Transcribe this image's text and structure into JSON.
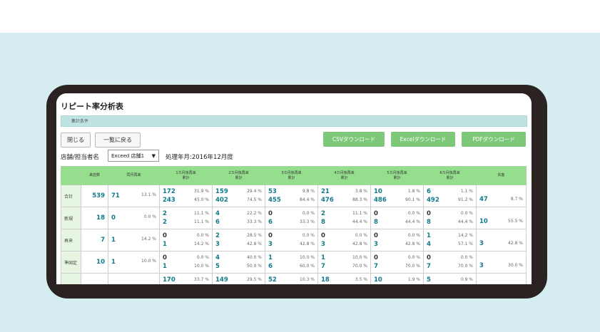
{
  "title": "リピート率分析表",
  "conditions_label": "集計条件",
  "buttons": {
    "close": "閉じる",
    "back": "一覧に戻る",
    "csv": "CSVダウンロード",
    "excel": "Excelダウンロード",
    "pdf": "PDFダウンロード"
  },
  "filter": {
    "label": "店舗/担当者名",
    "value": "Exceed 店舗1",
    "month_label": "処理年月:2016年12月度"
  },
  "headers": [
    "来店数",
    "同月再来",
    "1カ月後再来\n累計",
    "2カ月後再来\n累計",
    "3カ月後再来\n累計",
    "4カ月後再来\n累計",
    "5カ月後再来\n累計",
    "6カ月後再来\n累計",
    "失客"
  ],
  "rows": [
    {
      "label": "合計",
      "visits": "539",
      "same": "71",
      "same_pct": "13.1 %",
      "months": [
        [
          [
            "172",
            "31.9 %"
          ],
          [
            "243",
            "45.0 %"
          ]
        ],
        [
          [
            "159",
            "29.4 %"
          ],
          [
            "402",
            "74.5 %"
          ]
        ],
        [
          [
            "53",
            "9.8 %"
          ],
          [
            "455",
            "84.4 %"
          ]
        ],
        [
          [
            "21",
            "3.8 %"
          ],
          [
            "476",
            "88.3 %"
          ]
        ],
        [
          [
            "10",
            "1.8 %"
          ],
          [
            "486",
            "90.1 %"
          ]
        ],
        [
          [
            "6",
            "1.1 %"
          ],
          [
            "492",
            "91.2 %"
          ]
        ]
      ],
      "lost": "47",
      "lost_pct": "8.7 %"
    },
    {
      "label": "新規",
      "visits": "18",
      "same": "0",
      "same_pct": "0.0 %",
      "months": [
        [
          [
            "2",
            "11.1 %"
          ],
          [
            "2",
            "11.1 %"
          ]
        ],
        [
          [
            "4",
            "22.2 %"
          ],
          [
            "6",
            "33.3 %"
          ]
        ],
        [
          [
            "0",
            "0.0 %"
          ],
          [
            "6",
            "33.3 %"
          ]
        ],
        [
          [
            "2",
            "11.1 %"
          ],
          [
            "8",
            "44.4 %"
          ]
        ],
        [
          [
            "0",
            "0.0 %"
          ],
          [
            "8",
            "44.4 %"
          ]
        ],
        [
          [
            "0",
            "0.0 %"
          ],
          [
            "8",
            "44.4 %"
          ]
        ]
      ],
      "lost": "10",
      "lost_pct": "55.5 %"
    },
    {
      "label": "再来",
      "visits": "7",
      "same": "1",
      "same_pct": "14.2 %",
      "months": [
        [
          [
            "0",
            "0.0 %"
          ],
          [
            "1",
            "14.2 %"
          ]
        ],
        [
          [
            "2",
            "28.5 %"
          ],
          [
            "3",
            "42.8 %"
          ]
        ],
        [
          [
            "0",
            "0.0 %"
          ],
          [
            "3",
            "42.8 %"
          ]
        ],
        [
          [
            "0",
            "0.0 %"
          ],
          [
            "3",
            "42.8 %"
          ]
        ],
        [
          [
            "0",
            "0.0 %"
          ],
          [
            "3",
            "42.8 %"
          ]
        ],
        [
          [
            "1",
            "14.2 %"
          ],
          [
            "4",
            "57.1 %"
          ]
        ]
      ],
      "lost": "3",
      "lost_pct": "42.8 %"
    },
    {
      "label": "準固定",
      "visits": "10",
      "same": "1",
      "same_pct": "10.0 %",
      "months": [
        [
          [
            "0",
            "0.0 %"
          ],
          [
            "1",
            "10.0 %"
          ]
        ],
        [
          [
            "4",
            "40.0 %"
          ],
          [
            "5",
            "50.0 %"
          ]
        ],
        [
          [
            "1",
            "10.0 %"
          ],
          [
            "6",
            "60.0 %"
          ]
        ],
        [
          [
            "1",
            "10.0 %"
          ],
          [
            "7",
            "70.0 %"
          ]
        ],
        [
          [
            "0",
            "0.0 %"
          ],
          [
            "7",
            "70.0 %"
          ]
        ],
        [
          [
            "0",
            "0.0 %"
          ],
          [
            "7",
            "70.0 %"
          ]
        ]
      ],
      "lost": "3",
      "lost_pct": "30.0 %"
    },
    {
      "label": "",
      "visits": "",
      "same": "",
      "same_pct": "",
      "months": [
        [
          [
            "170",
            "33.7 %"
          ],
          [
            "",
            ""
          ]
        ],
        [
          [
            "149",
            "29.5 %"
          ],
          [
            "",
            ""
          ]
        ],
        [
          [
            "52",
            "10.3 %"
          ],
          [
            "",
            ""
          ]
        ],
        [
          [
            "18",
            "3.5 %"
          ],
          [
            "",
            ""
          ]
        ],
        [
          [
            "10",
            "1.9 %"
          ],
          [
            "",
            ""
          ]
        ],
        [
          [
            "5",
            "0.9 %"
          ],
          [
            "",
            ""
          ]
        ]
      ],
      "lost": "",
      "lost_pct": ""
    }
  ]
}
